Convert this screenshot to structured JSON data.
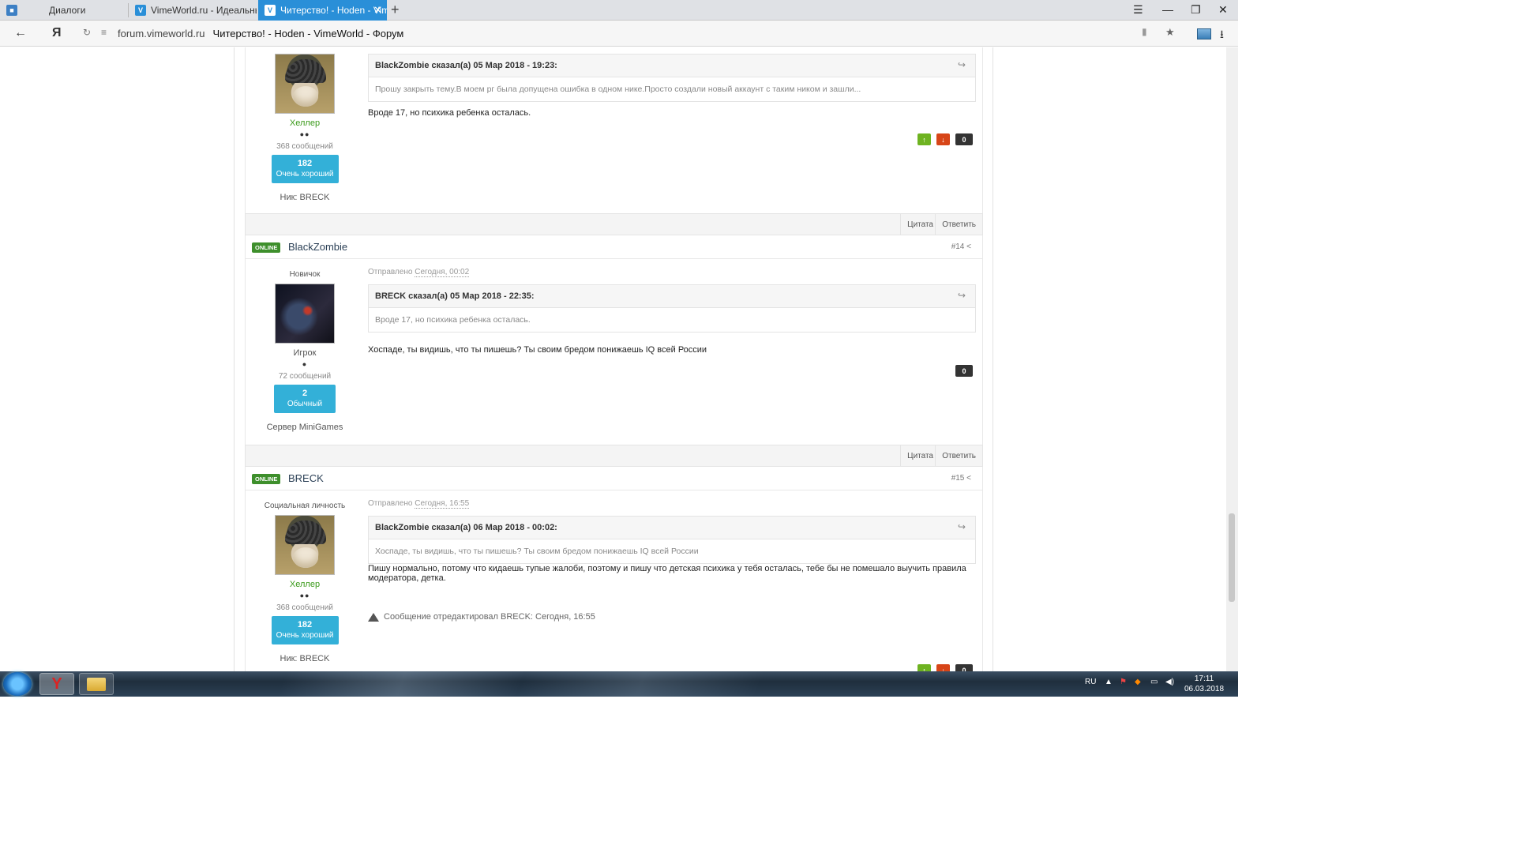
{
  "browser": {
    "tabs": [
      {
        "label": "Диалоги",
        "icon": "chat-icon",
        "active": false
      },
      {
        "label": "VimeWorld.ru - Идеальные",
        "icon": "vimeworld-icon",
        "active": false
      },
      {
        "label": "Читерство! - Hoden - Vim",
        "icon": "vimeworld-icon",
        "active": true
      }
    ],
    "address_domain": "forum.vimeworld.ru",
    "address_title": "Читерство! - Hoden - VimeWorld - Форум"
  },
  "posts": [
    {
      "author": {
        "group": "Хеллер",
        "pips": "●●",
        "post_count": "368 сообщений",
        "rep_value": "182",
        "rep_label": "Очень хороший",
        "extra": "Ник: BRECK"
      },
      "quote_head": "BlackZombie сказал(а) 05 Мар 2018 - 19:23:",
      "quote_body": "Прошу закрыть тему.В моем рг была допущена ошибка в одном нике.Просто создали новый аккаунт с таким ником и зашли...",
      "text": "Вроде 17, но психика ребенка осталась.",
      "votes": "0"
    },
    {
      "header": {
        "badge": "ONLINE",
        "name": "BlackZombie",
        "num": "#14"
      },
      "author": {
        "rank_top": "Новичок",
        "group": "Игрок",
        "pips": "●",
        "post_count": "72 сообщений",
        "rep_value": "2",
        "rep_label": "Обычный",
        "extra": "Сервер MiniGames"
      },
      "posted_prefix": "Отправлено",
      "posted_time": "Сегодня, 00:02",
      "quote_head": "BRECK сказал(а) 05 Мар 2018 - 22:35:",
      "quote_body": "Вроде 17, но психика ребенка осталась.",
      "text": "Хоспаде, ты видишь, что ты пишешь? Ты своим бредом понижаешь IQ всей России",
      "votes": "0"
    },
    {
      "header": {
        "badge": "ONLINE",
        "name": "BRECK",
        "num": "#15"
      },
      "author": {
        "rank_top": "Социальная личность",
        "group": "Хеллер",
        "pips": "●●",
        "post_count": "368 сообщений",
        "rep_value": "182",
        "rep_label": "Очень хороший",
        "extra": "Ник: BRECK"
      },
      "posted_prefix": "Отправлено",
      "posted_time": "Сегодня, 16:55",
      "quote_head": "BlackZombie сказал(а) 06 Мар 2018 - 00:02:",
      "quote_body": "Хоспаде, ты видишь, что ты пишешь? Ты своим бредом понижаешь IQ всей России",
      "text": "Пишу нормально, потому что кидаешь тупые жалоби, поэтому и пишу что детская психика у тебя осталась, тебе бы не помешало выучить правила модератора, детка.",
      "edited": "Сообщение отредактировал BRECK: Сегодня, 16:55",
      "votes": "0"
    }
  ],
  "footer": {
    "quote_label": "Цитата",
    "reply_label": "Ответить"
  },
  "taskbar": {
    "lang": "RU",
    "time": "17:11",
    "date": "06.03.2018"
  }
}
